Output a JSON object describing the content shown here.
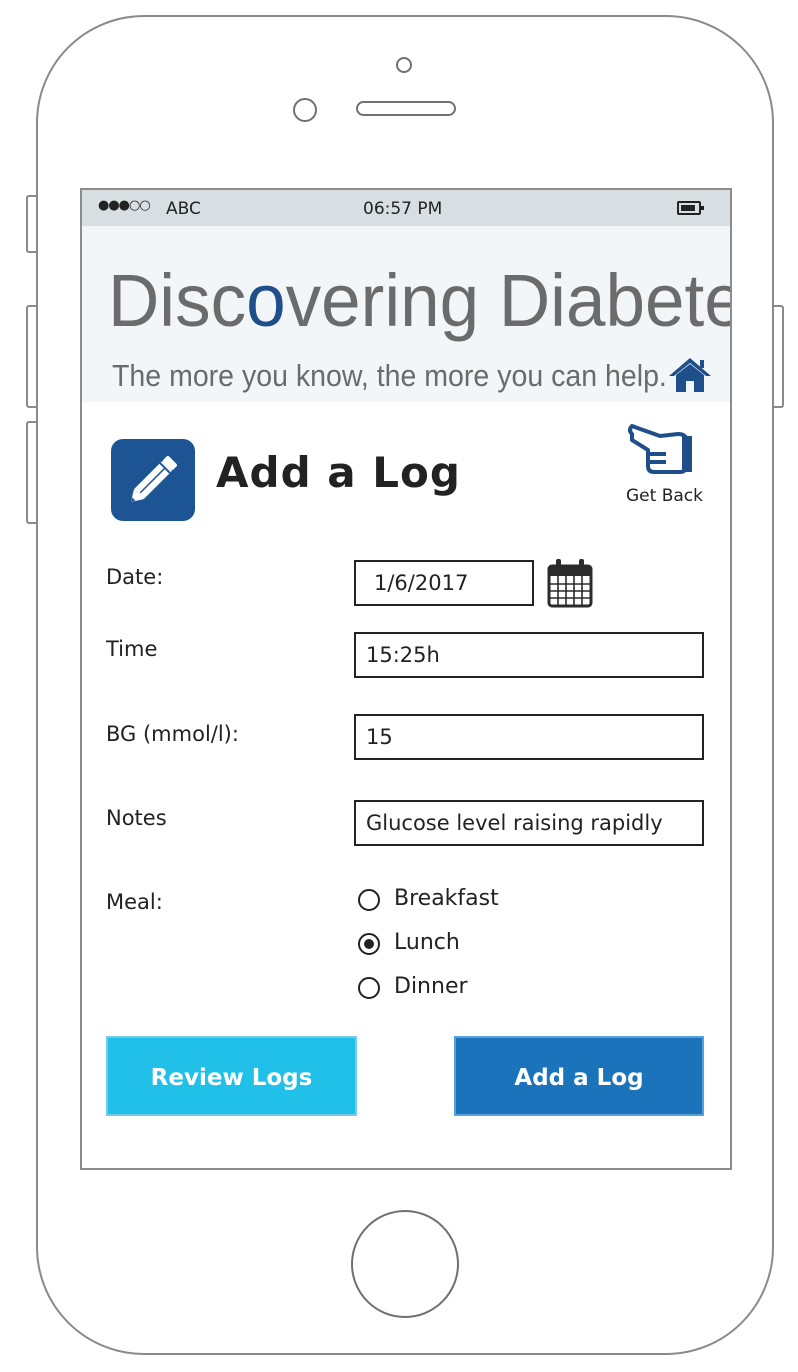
{
  "status_bar": {
    "signal": "●●●○○",
    "carrier": "ABC",
    "time": "06:57 PM"
  },
  "banner": {
    "title_pre": "Disc",
    "title_accent": "o",
    "title_post": "vering Diabetes",
    "tagline": "The more you know, the more you can help.",
    "home_icon": "home-icon",
    "accent_color": "#1e4f8a"
  },
  "header": {
    "icon": "pencil-icon",
    "title": "Add a Log",
    "back_icon": "pointing-hand-icon",
    "back_label": "Get Back"
  },
  "form": {
    "date_label": "Date:",
    "date_value": "1/6/2017",
    "time_label": "Time",
    "time_value": "15:25h",
    "bg_label": "BG (mmol/l):",
    "bg_value": "15",
    "notes_label": "Notes",
    "notes_value": "Glucose level raising rapidly",
    "meal_label": "Meal:",
    "meal_options": [
      "Breakfast",
      "Lunch",
      "Dinner"
    ],
    "meal_selected": "Lunch"
  },
  "buttons": {
    "review_label": "Review Logs",
    "add_label": "Add a Log",
    "review_color": "#21c0e8",
    "add_color": "#1a73bb"
  }
}
